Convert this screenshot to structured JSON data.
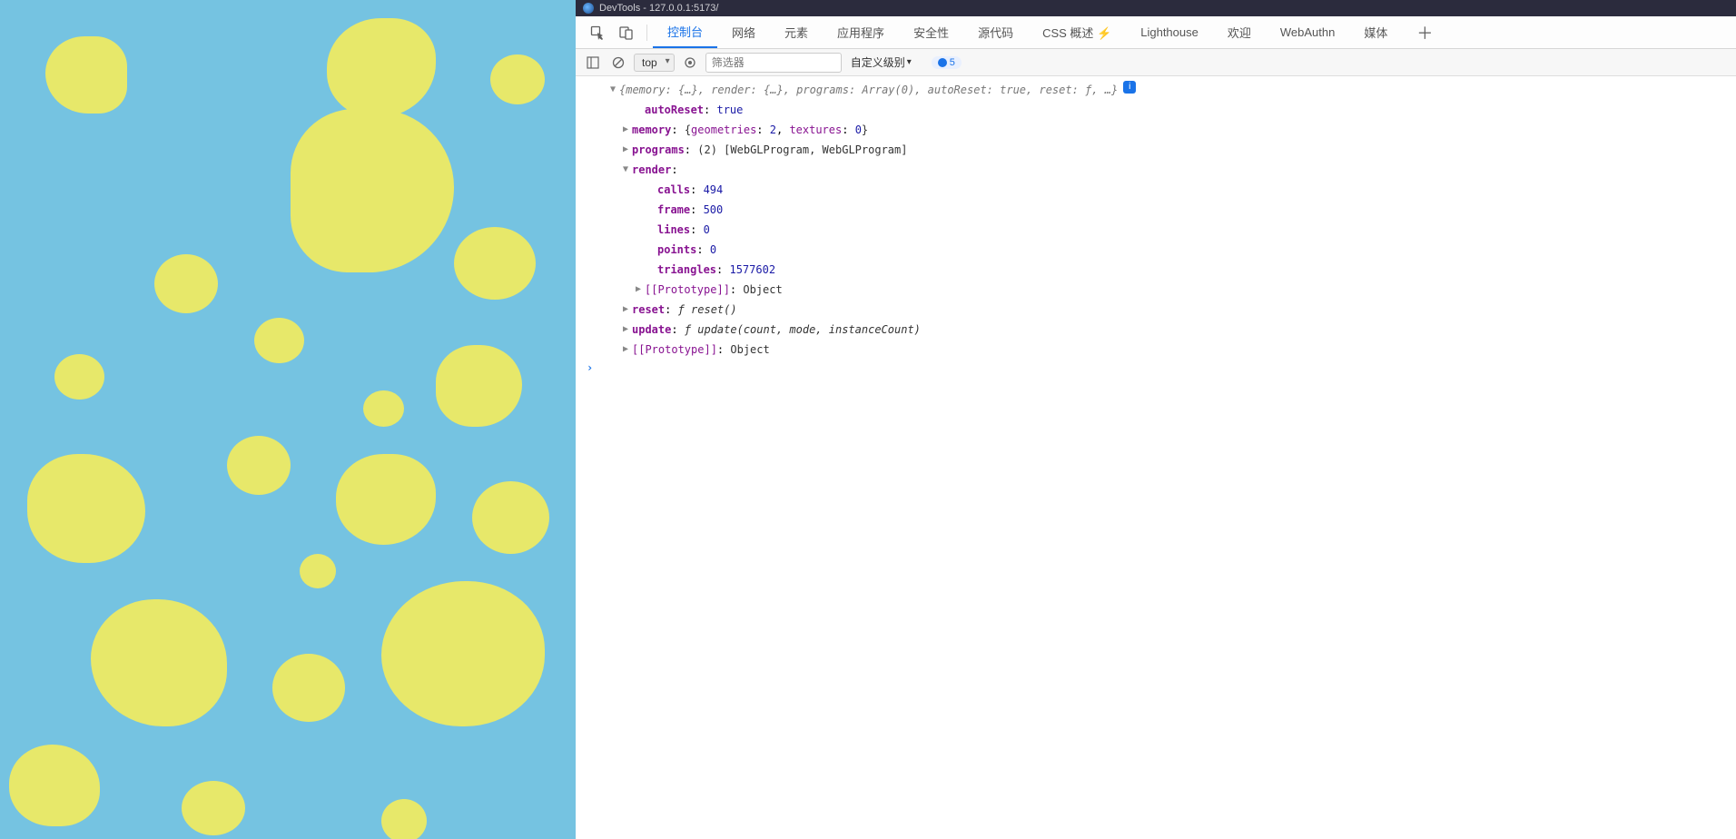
{
  "window": {
    "title": "DevTools - 127.0.0.1:5173/"
  },
  "tabs": {
    "items": [
      "控制台",
      "网络",
      "元素",
      "应用程序",
      "安全性",
      "源代码",
      "CSS 概述 ⚡",
      "Lighthouse",
      "欢迎",
      "WebAuthn",
      "媒体"
    ],
    "active": "控制台"
  },
  "filter_bar": {
    "context": "top",
    "filter_placeholder": "筛选器",
    "levels_label": "自定义级别",
    "issues_count": "5"
  },
  "console": {
    "summary_prefix": "{",
    "summary_parts": [
      {
        "k": "memory",
        "v": "{…}"
      },
      {
        "k": "render",
        "v": "{…}"
      },
      {
        "k": "programs",
        "v": "Array(0)"
      },
      {
        "k": "autoReset",
        "v": "true"
      },
      {
        "k": "reset",
        "v": "ƒ"
      },
      {
        "k": "…",
        "v": ""
      }
    ],
    "summary_suffix": "}",
    "autoReset": {
      "label": "autoReset",
      "value": "true"
    },
    "memory": {
      "label": "memory",
      "inline": "{geometries: 2, textures: 0}",
      "geometries": "2",
      "textures": "0"
    },
    "programs": {
      "label": "programs",
      "count": "(2)",
      "inline": "[WebGLProgram, WebGLProgram]"
    },
    "render": {
      "label": "render",
      "calls": {
        "label": "calls",
        "value": "494"
      },
      "frame": {
        "label": "frame",
        "value": "500"
      },
      "lines": {
        "label": "lines",
        "value": "0"
      },
      "points": {
        "label": "points",
        "value": "0"
      },
      "triangles": {
        "label": "triangles",
        "value": "1577602"
      },
      "proto": {
        "label": "[[Prototype]]",
        "value": "Object"
      }
    },
    "reset": {
      "label": "reset",
      "sig": "ƒ reset()"
    },
    "update": {
      "label": "update",
      "sig": "ƒ update(count, mode, instanceCount)"
    },
    "proto": {
      "label": "[[Prototype]]",
      "value": "Object"
    }
  }
}
